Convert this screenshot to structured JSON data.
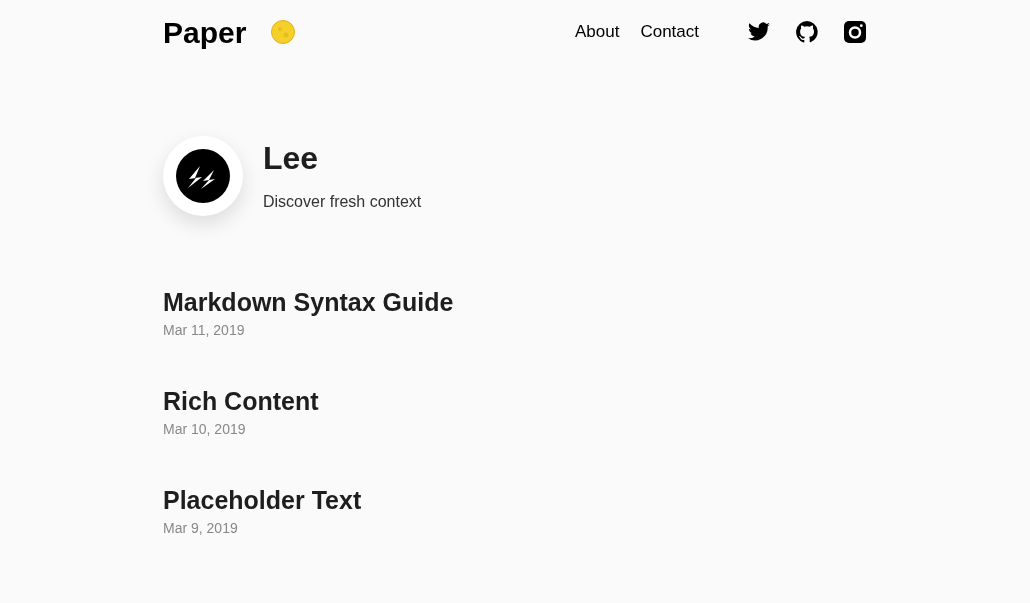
{
  "header": {
    "logo": "Paper",
    "nav": [
      "About",
      "Contact"
    ]
  },
  "profile": {
    "name": "Lee",
    "bio": "Discover fresh context"
  },
  "posts": [
    {
      "title": "Markdown Syntax Guide",
      "date": "Mar 11, 2019"
    },
    {
      "title": "Rich Content",
      "date": "Mar 10, 2019"
    },
    {
      "title": "Placeholder Text",
      "date": "Mar 9, 2019"
    }
  ]
}
